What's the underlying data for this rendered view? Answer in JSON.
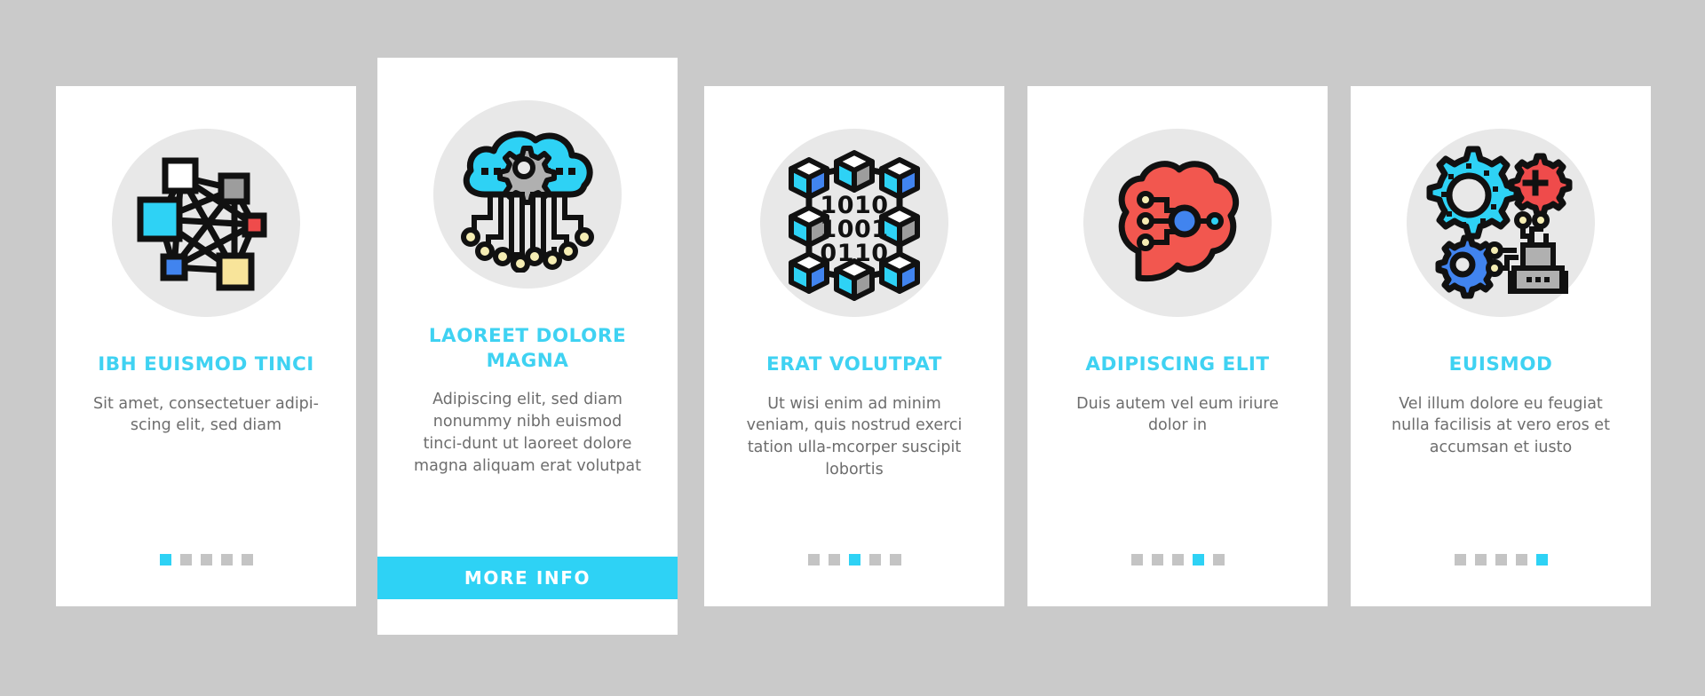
{
  "page": {
    "background_color": "#cacaca",
    "card_background": "#ffffff",
    "accent_color": "#2ed2f5",
    "title_color": "#3fd2f2",
    "body_text_color": "#6d6d6d",
    "dot_inactive_color": "#c4c4c4",
    "icon_circle_color": "#e8e8e8"
  },
  "cards": [
    {
      "id": "card-1",
      "icon_name": "neural-network-icon",
      "title": "IBH EUISMOD TINCI",
      "description": "Sit amet, consectetuer adipi-scing elit, sed diam",
      "dots": {
        "count": 5,
        "active_index": 0
      },
      "featured": false,
      "icon_colors": {
        "node_white": "#ffffff",
        "node_gray": "#9d9d9d",
        "node_cyan": "#2ed2f5",
        "node_red": "#ef4b4b",
        "node_blue": "#4184ef",
        "node_yellow": "#f8e49a",
        "stroke": "#111111"
      }
    },
    {
      "id": "card-2",
      "icon_name": "cloud-computing-icon",
      "title": "LAOREET DOLORE MAGNA",
      "description": "Adipiscing elit, sed diam nonummy nibh euismod tinci-dunt ut laoreet dolore magna aliquam erat volutpat",
      "button_label": "MORE INFO",
      "featured": true,
      "icon_colors": {
        "cloud": "#2ed2f5",
        "gear": "#b0b0b0",
        "node_dot": "#f5edb3",
        "stroke": "#111111"
      }
    },
    {
      "id": "card-3",
      "icon_name": "blockchain-icon",
      "title": "ERAT VOLUTPAT",
      "description": "Ut wisi enim ad minim veniam, quis nostrud exerci tation ulla-mcorper suscipit lobortis",
      "dots": {
        "count": 5,
        "active_index": 2
      },
      "featured": false,
      "binary_lines": [
        "1010",
        "1001",
        "0110"
      ],
      "icon_colors": {
        "cube_top": "#ffffff",
        "cube_left": "#2ed2f5",
        "cube_right_blue": "#4184ef",
        "cube_right_gray": "#9d9d9d",
        "stroke": "#111111"
      }
    },
    {
      "id": "card-4",
      "icon_name": "ai-brain-icon",
      "title": "ADIPISCING ELIT",
      "description": "Duis autem vel eum iriure dolor in",
      "dots": {
        "count": 5,
        "active_index": 3
      },
      "featured": false,
      "icon_colors": {
        "brain": "#f2574f",
        "hub_node": "#4184ef",
        "small_node_cyan": "#2ed2f5",
        "small_node_yellow": "#f5edb3",
        "stroke": "#111111"
      }
    },
    {
      "id": "card-5",
      "icon_name": "automation-robot-icon",
      "title": "EUISMOD",
      "description": "Vel illum dolore eu feugiat nulla facilisis at vero eros et accumsan et iusto",
      "dots": {
        "count": 5,
        "active_index": 4
      },
      "featured": false,
      "icon_colors": {
        "gear_large": "#2ed2f5",
        "gear_red": "#ef4b4b",
        "gear_blue": "#4184ef",
        "robot": "#b0b0b0",
        "node_dot": "#f5edb3",
        "stroke": "#111111"
      }
    }
  ]
}
